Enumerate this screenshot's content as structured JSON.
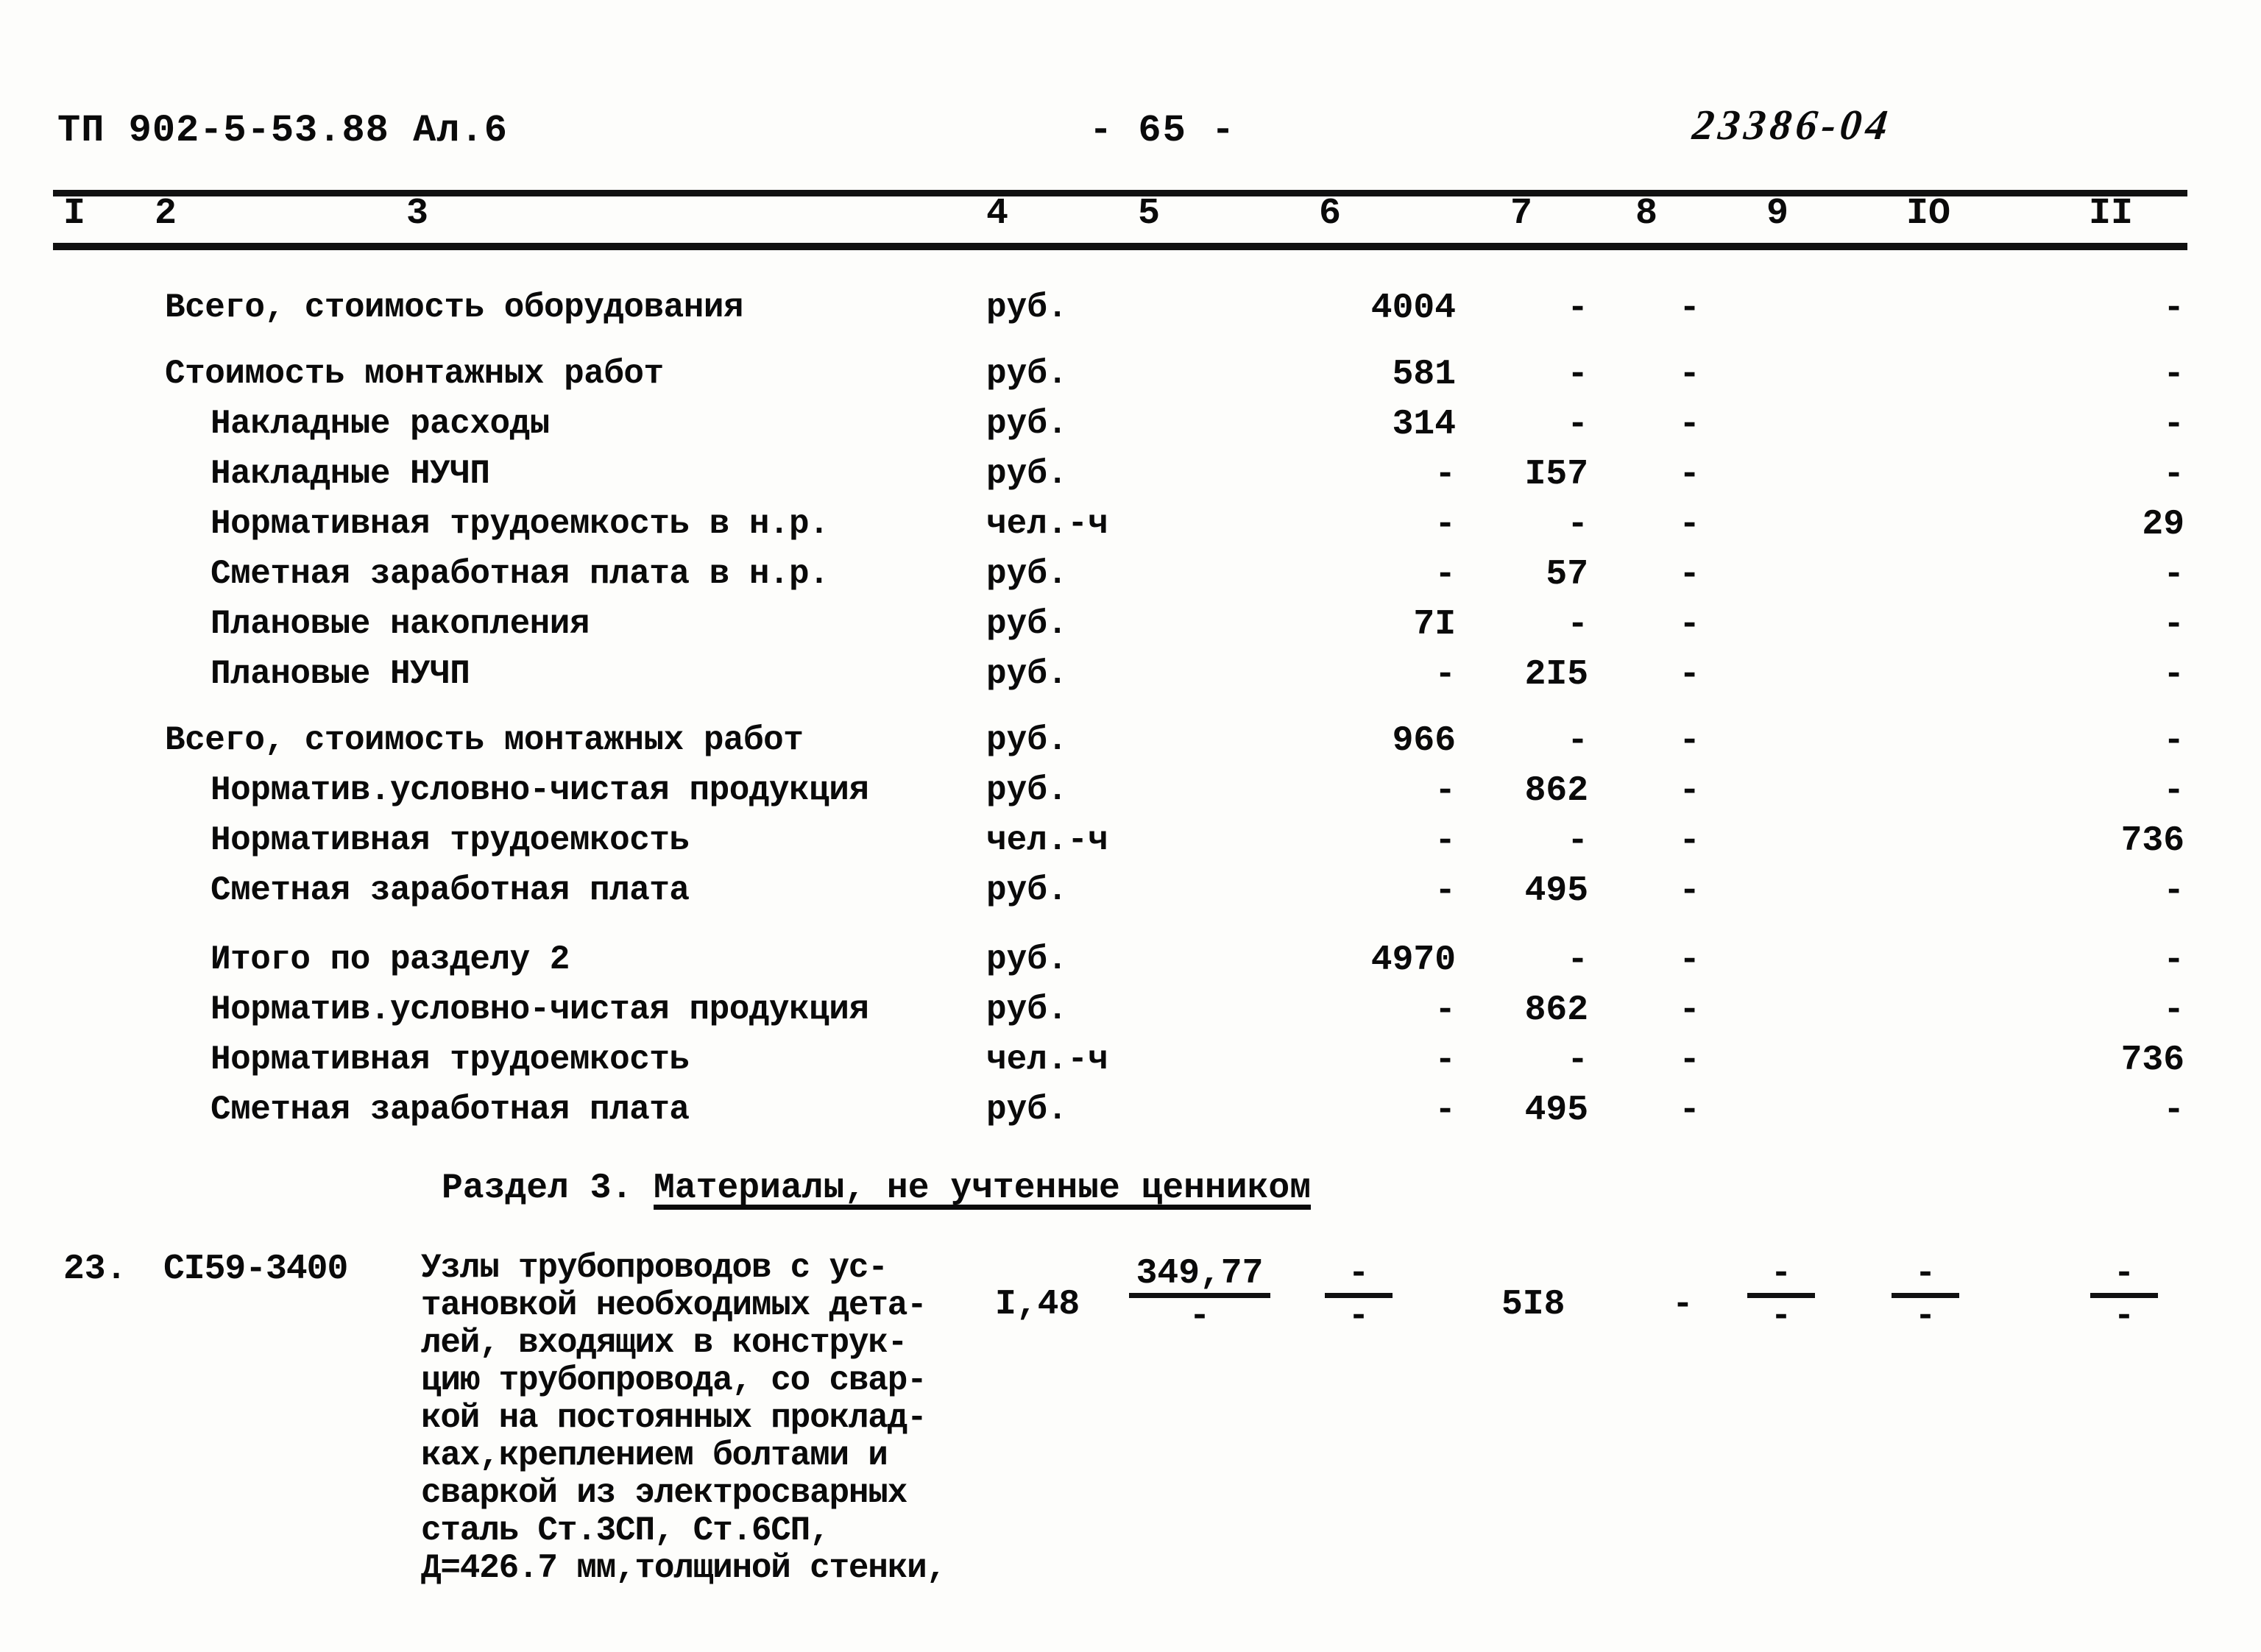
{
  "header": {
    "document_code": "ТП 902-5-53.88  Ал.6",
    "page_number": "- 65 -",
    "stamp": "23386-04"
  },
  "table": {
    "column_numbers": [
      "I",
      "2",
      "3",
      "4",
      "5",
      "6",
      "7",
      "8",
      "9",
      "IO",
      "II"
    ],
    "dash": "-",
    "rows": [
      {
        "desc": "Всего, стоимость оборудования",
        "indent": 0,
        "unit": "руб.",
        "c7": "4004",
        "c8": "-",
        "c9": "-",
        "c10": "",
        "c11": "-"
      },
      {
        "desc": "Стоимость монтажных работ",
        "indent": 0,
        "unit": "руб.",
        "c7": "581",
        "c8": "-",
        "c9": "-",
        "c10": "",
        "c11": "-"
      },
      {
        "desc": "Накладные расходы",
        "indent": 1,
        "unit": "руб.",
        "c7": "314",
        "c8": "-",
        "c9": "-",
        "c10": "",
        "c11": "-"
      },
      {
        "desc": "Накладные НУЧП",
        "indent": 1,
        "unit": "руб.",
        "c7": "-",
        "c8": "I57",
        "c9": "-",
        "c10": "",
        "c11": "-"
      },
      {
        "desc": "Нормативная трудоемкость в н.р.",
        "indent": 1,
        "unit": "чел.-ч",
        "c7": "-",
        "c8": "-",
        "c9": "-",
        "c10": "",
        "c11": "29"
      },
      {
        "desc": "Сметная заработная плата в н.р.",
        "indent": 1,
        "unit": "руб.",
        "c7": "-",
        "c8": "57",
        "c9": "-",
        "c10": "",
        "c11": "-"
      },
      {
        "desc": "Плановые накопления",
        "indent": 1,
        "unit": "руб.",
        "c7": "7I",
        "c8": "-",
        "c9": "-",
        "c10": "",
        "c11": "-"
      },
      {
        "desc": "Плановые НУЧП",
        "indent": 1,
        "unit": "руб.",
        "c7": "-",
        "c8": "2I5",
        "c9": "-",
        "c10": "",
        "c11": "-"
      },
      {
        "desc": "Всего, стоимость монтажных работ",
        "indent": 0,
        "unit": "руб.",
        "c7": "966",
        "c8": "-",
        "c9": "-",
        "c10": "",
        "c11": "-"
      },
      {
        "desc": "Норматив.условно-чистая продукция",
        "indent": 1,
        "unit": "руб.",
        "c7": "-",
        "c8": "862",
        "c9": "-",
        "c10": "",
        "c11": "-"
      },
      {
        "desc": "Нормативная трудоемкость",
        "indent": 1,
        "unit": "чел.-ч",
        "c7": "-",
        "c8": "-",
        "c9": "-",
        "c10": "",
        "c11": "736"
      },
      {
        "desc": "Сметная заработная плата",
        "indent": 1,
        "unit": "руб.",
        "c7": "-",
        "c8": "495",
        "c9": "-",
        "c10": "",
        "c11": "-"
      },
      {
        "desc": "Итого по разделу 2",
        "indent": 1,
        "unit": "руб.",
        "spacer": true,
        "c7": "4970",
        "c8": "-",
        "c9": "-",
        "c10": "",
        "c11": "-"
      },
      {
        "desc": "Норматив.условно-чистая продукция",
        "indent": 1,
        "unit": "руб.",
        "c7": "-",
        "c8": "862",
        "c9": "-",
        "c10": "",
        "c11": "-"
      },
      {
        "desc": "Нормативная трудоемкость",
        "indent": 1,
        "unit": "чел.-ч",
        "c7": "-",
        "c8": "-",
        "c9": "-",
        "c10": "",
        "c11": "736"
      },
      {
        "desc": "Сметная заработная плата",
        "indent": 1,
        "unit": "руб.",
        "c7": "-",
        "c8": "495",
        "c9": "-",
        "c10": "",
        "c11": "-"
      }
    ]
  },
  "section": {
    "prefix": "Раздел 3. ",
    "underlined": "Материалы, не учтенные ценником"
  },
  "item": {
    "number": "23.",
    "code": "СI59-3400",
    "description": "Узлы трубопроводов с ус-\nтановкой необходимых дета-\nлей, входящих в конструк-\nцию трубопровода, со свар-\nкой на постоянных проклад-\nках,креплением болтами и\nсваркой из электросварных\nсталь Ст.3СП, Ст.6СП,\nД=426.7 мм,толщиной стенки,",
    "qty": "I,48",
    "col5_num": "349,77",
    "col5_den": "-",
    "col6_num": "-",
    "col6_den": "-",
    "col7": "5I8",
    "col8": "-",
    "col9_num": "-",
    "col9_den": "-",
    "col10_num": "-",
    "col10_den": "-",
    "col11_num": "-",
    "col11_den": "-"
  }
}
